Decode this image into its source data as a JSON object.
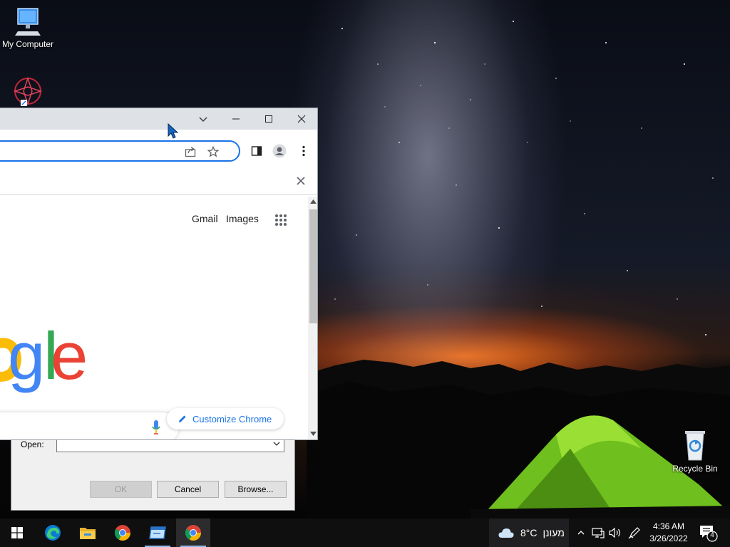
{
  "desktop": {
    "icons": [
      {
        "label": "My Computer"
      },
      {
        "label": ""
      },
      {
        "label": "Recycle Bin"
      }
    ]
  },
  "run_dialog": {
    "open_label": "Open:",
    "open_value": "",
    "ok_label": "OK",
    "cancel_label": "Cancel",
    "browse_label": "Browse..."
  },
  "chrome": {
    "omnibox_value": "",
    "top_links": {
      "gmail": "Gmail",
      "images": "Images"
    },
    "logo_letters": [
      {
        "ch": "g",
        "color": "#4285f4"
      },
      {
        "ch": "l",
        "color": "#34a853"
      },
      {
        "ch": "e",
        "color": "#ea4335"
      }
    ],
    "logo_partial_letter_color": "#fbbc05",
    "customize_label": "Customize Chrome"
  },
  "taskbar": {
    "apps": [
      "start",
      "edge",
      "file-explorer",
      "chrome",
      "run-app",
      "chrome-active"
    ],
    "weather_temp": "8°C",
    "weather_text": "מעונן",
    "time": "4:36 AM",
    "date": "3/26/2022",
    "notification_count": "4"
  },
  "colors": {
    "accent": "#1a73e8",
    "taskbar": "#0f0f10",
    "titlebar": "#dee1e6"
  }
}
